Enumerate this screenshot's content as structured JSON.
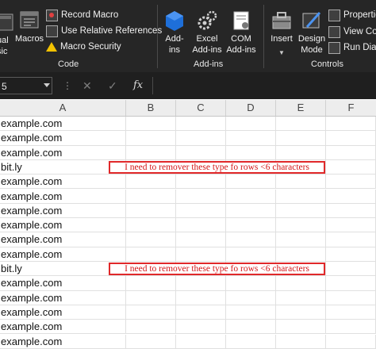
{
  "ribbon": {
    "visual_basic_label": "ual\nsic",
    "macros_label": "Macros",
    "record_macro_label": "Record Macro",
    "relative_refs_label": "Use Relative References",
    "macro_security_label": "Macro Security",
    "code_group_label": "Code",
    "addins_label": "Add-\nins",
    "excel_addins_label": "Excel\nAdd-ins",
    "com_addins_label": "COM\nAdd-ins",
    "addins_group_label": "Add-ins",
    "insert_label": "Insert",
    "design_mode_label": "Design\nMode",
    "properties_label": "Propertie",
    "view_code_label": "View Cod",
    "run_dialog_label": "Run Dialo",
    "controls_group_label": "Controls"
  },
  "formula_bar": {
    "name_box_value": "5",
    "fx_label": "fx",
    "cancel_glyph": "✕",
    "enter_glyph": "✓"
  },
  "columns": [
    "A",
    "B",
    "C",
    "D",
    "E",
    "F"
  ],
  "rows": [
    "example.com",
    "example.com",
    "example.com",
    "bit.ly",
    "example.com",
    "example.com",
    "example.com",
    "example.com",
    "example.com",
    "example.com",
    "bit.ly",
    "example.com",
    "example.com",
    "example.com",
    "example.com",
    "example.com"
  ],
  "annotations": [
    {
      "text": "I need to remover these type fo rows <6 characters",
      "row_index": 3
    },
    {
      "text": "I need to remover these type fo rows <6 characters",
      "row_index": 10
    }
  ],
  "colors": {
    "ribbon_bg": "#262626",
    "annotation_border": "#e0282a",
    "annotation_text": "#d4171a"
  }
}
